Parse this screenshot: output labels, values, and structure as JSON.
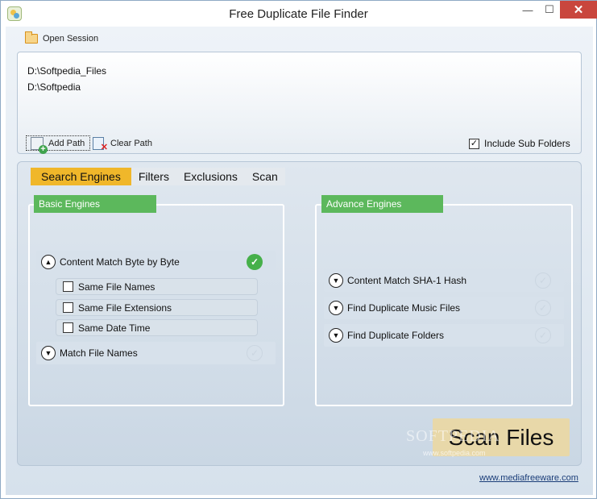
{
  "window": {
    "title": "Free Duplicate File Finder",
    "minimize": "—",
    "maximize": "☐",
    "close": "✕"
  },
  "toolbar": {
    "open_session": "Open Session"
  },
  "paths": [
    "D:\\Softpedia_Files",
    "D:\\Softpedia"
  ],
  "path_actions": {
    "add_path": "Add Path",
    "clear_path": "Clear Path"
  },
  "include_sub_folders": {
    "label": "Include Sub Folders",
    "checked": true,
    "mark": "✓"
  },
  "tabs": [
    "Search Engines",
    "Filters",
    "Exclusions",
    "Scan"
  ],
  "active_tab": "Search Engines",
  "basic_engines": {
    "header": "Basic Engines",
    "content_match": {
      "label": "Content Match Byte by Byte",
      "expanded": true,
      "enabled": true,
      "options": [
        "Same File Names",
        "Same File Extensions",
        "Same Date Time"
      ]
    },
    "match_file_names": {
      "label": "Match File Names",
      "expanded": false,
      "enabled": false
    }
  },
  "advance_engines": {
    "header": "Advance Engines",
    "items": [
      "Content Match SHA-1 Hash",
      "Find Duplicate Music Files",
      "Find Duplicate Folders"
    ]
  },
  "scan_button": "Scan Files",
  "watermark": "SOFTPEDIA",
  "watermark_url": "www.softpedia.com",
  "footer_link": "www.mediafreeware.com",
  "colors": {
    "accent_tab": "#f0b72a",
    "section_header": "#5cb85c",
    "scan_button": "#e8d8a9",
    "close_button": "#c9463d"
  }
}
